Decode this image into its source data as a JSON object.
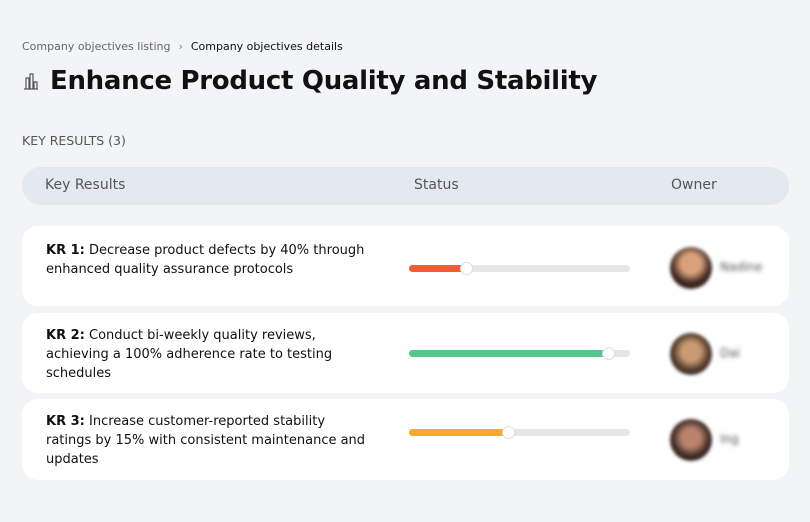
{
  "breadcrumb": {
    "items": [
      "Company objectives listing",
      "Company objectives details"
    ]
  },
  "page": {
    "title": "Enhance Product Quality and Stability",
    "icon": "building-chart-icon"
  },
  "section": {
    "label": "KEY RESULTS (3)"
  },
  "table": {
    "headers": [
      "Key Results",
      "Status",
      "Owner"
    ],
    "rows": [
      {
        "kr": "KR 1:",
        "text": "Decrease product defects by 40% through enhanced quality assurance protocols",
        "progress": 26,
        "color": "#f25c35",
        "owner": "Nadine"
      },
      {
        "kr": "KR 2:",
        "text": "Conduct bi-weekly quality reviews, achieving a 100% adherence rate to testing schedules",
        "progress": 90,
        "color": "#56c68e",
        "owner": "Dai"
      },
      {
        "kr": "KR 3:",
        "text": "Increase customer-reported stability ratings by 15% with consistent maintenance and updates",
        "progress": 45,
        "color": "#ffa62b",
        "owner": "Ing"
      }
    ]
  }
}
